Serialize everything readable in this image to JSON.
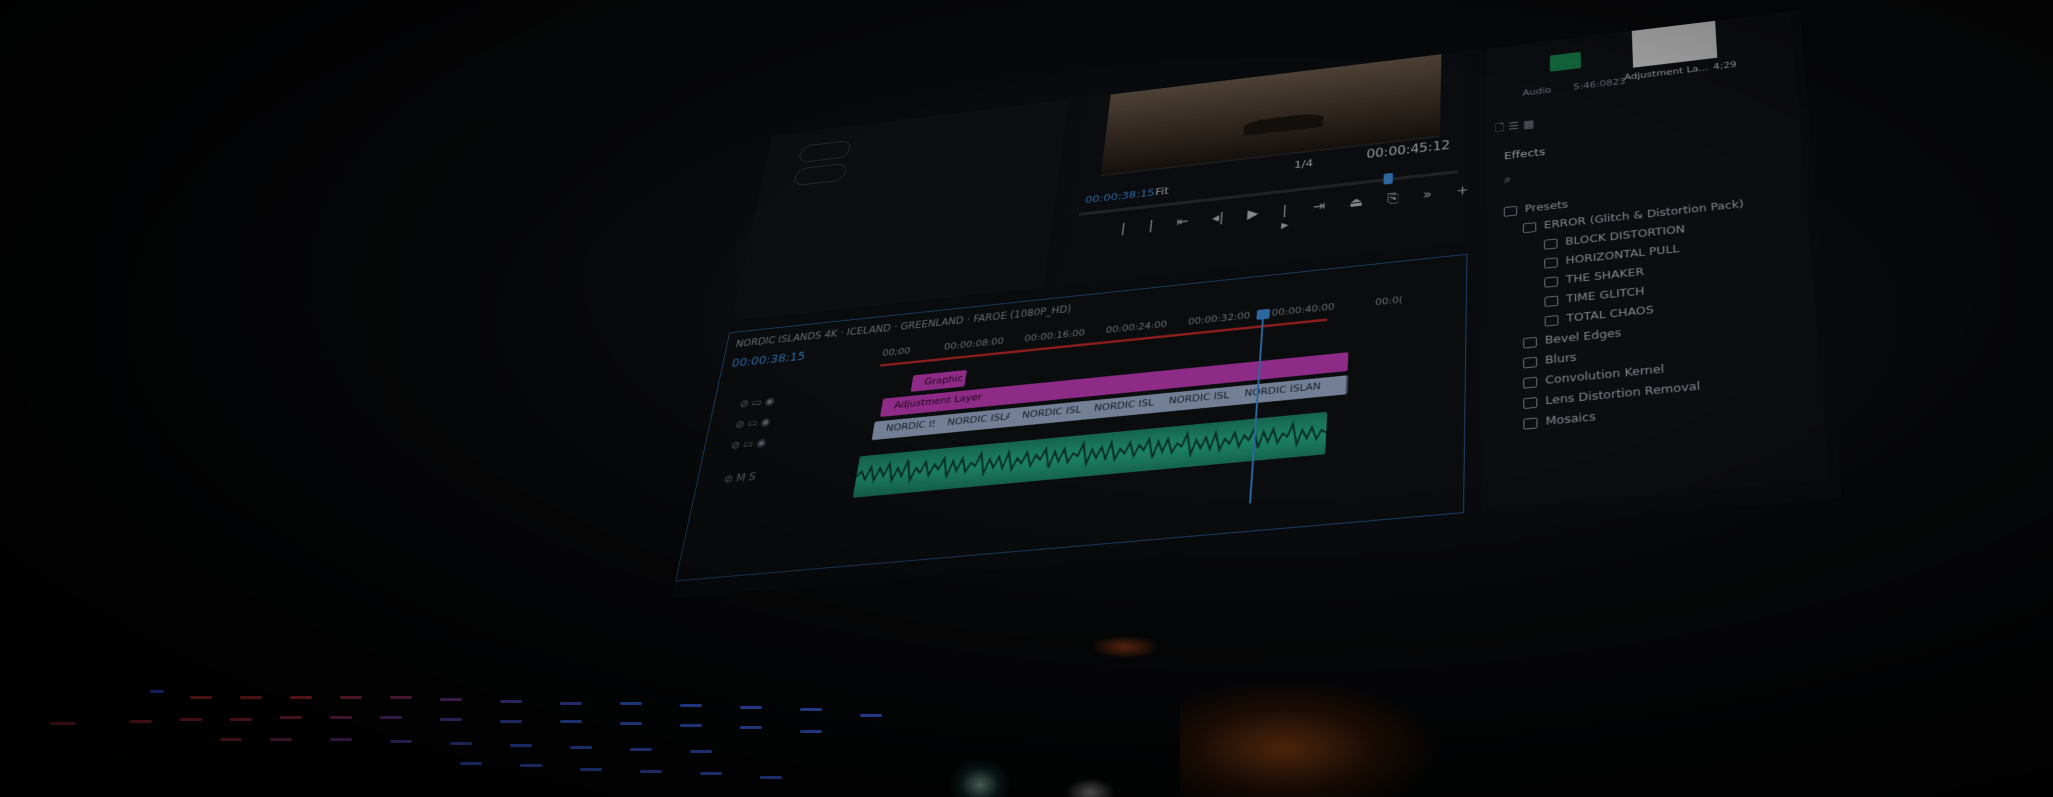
{
  "program_monitor": {
    "timecode_current": "00:00:38:15",
    "timecode_total": "00:00:45:12",
    "zoom": "Fit",
    "resolution": "1/4"
  },
  "project_panel": {
    "item_name": "Adjustment La...",
    "item_duration": "4;29",
    "audio_label": "Audio",
    "audio_duration": "5:46:0823"
  },
  "effects_panel": {
    "title": "Effects",
    "presets_label": "Presets",
    "error_pack": "ERROR (Glitch & Distortion Pack)",
    "preset_items": [
      "BLOCK DISTORTION",
      "HORIZONTAL PULL",
      "THE SHAKER",
      "TIME GLITCH",
      "TOTAL CHAOS"
    ],
    "folders": [
      "Bevel Edges",
      "Blurs",
      "Convolution Kernel",
      "Lens Distortion Removal",
      "Mosaics"
    ]
  },
  "timeline": {
    "sequence_name": "NORDIC ISLANDS 4K · ICELAND · GREENLAND · FAROE (1080P_HD)",
    "timecode": "00:00:38:15",
    "ruler": [
      "00;00",
      "00:00:08:00",
      "00:00:16:00",
      "00:00:24:00",
      "00:00:32:00",
      "00:00:40:00",
      "00:0("
    ],
    "graphic_clip": "Graphic",
    "adjustment_clip": "Adjustment Layer",
    "video_clips": [
      "NORDIC ISLAN",
      "NORDIC ISLAN",
      "NORDIC ISLA",
      "NORDIC ISL",
      "NORDIC ISL",
      "NORDIC ISLAN"
    ]
  },
  "colors": {
    "accent_blue": "#3d8fe0",
    "clip_pink": "#c43cba",
    "clip_video": "#9fb0cf",
    "audio_green": "#27b58c",
    "playhead_red": "#c02a2a"
  }
}
